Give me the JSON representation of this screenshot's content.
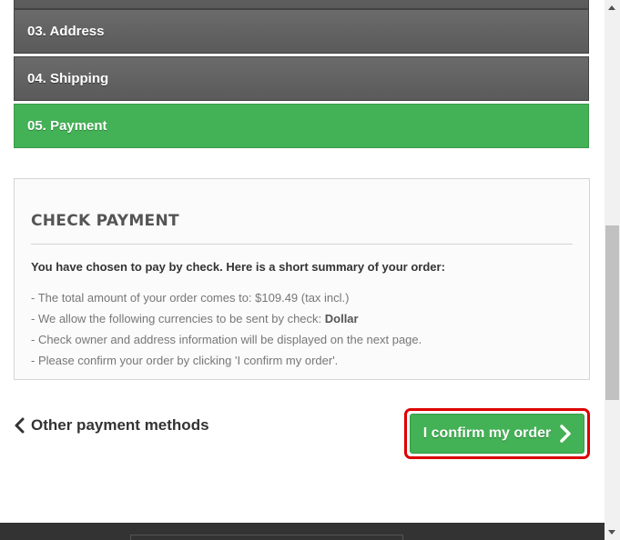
{
  "steps": [
    {
      "label": "03. Address"
    },
    {
      "label": "04. Shipping"
    },
    {
      "label": "05. Payment"
    }
  ],
  "panel": {
    "title": "CHECK PAYMENT",
    "summary": "You have chosen to pay by check. Here is a short summary of your order:",
    "lines": {
      "total": "- The total amount of your order comes to: $109.49 (tax incl.)",
      "currency_prefix": "- We allow the following currencies to be sent by check: ",
      "currency": "Dollar",
      "info": "- Check owner and address information will be displayed on the next page.",
      "confirm": "- Please confirm your order by clicking 'I confirm my order'."
    }
  },
  "actions": {
    "back_label": "Other payment methods",
    "confirm_label": "I confirm my order"
  },
  "colors": {
    "accent": "#43b155",
    "step_bg": "#5f5f5f",
    "highlight": "#dd0000"
  }
}
